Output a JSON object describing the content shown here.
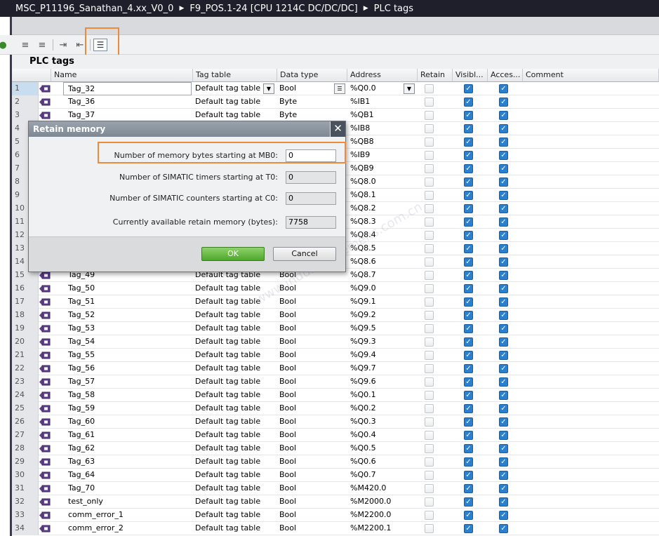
{
  "breadcrumb": [
    {
      "label": "MSC_P11196_Sanathan_4.xx_V0_0"
    },
    {
      "label": "F9_POS.1-24 [CPU 1214C DC/DC/DC]"
    },
    {
      "label": "PLC tags"
    }
  ],
  "toolbar": {
    "buttons": [
      {
        "name": "add-tag-icon",
        "glyph": "≡"
      },
      {
        "name": "insert-tag-icon",
        "glyph": "≡"
      },
      {
        "name": "export-icon",
        "glyph": "⇥"
      },
      {
        "name": "import-icon",
        "glyph": "⇤"
      },
      {
        "name": "retain-memory-icon",
        "glyph": "☰"
      }
    ]
  },
  "section": {
    "title": "PLC tags"
  },
  "columns": {
    "name": "Name",
    "tag_table": "Tag table",
    "data_type": "Data type",
    "address": "Address",
    "retain": "Retain",
    "visible": "Visibl...",
    "accessible": "Acces...",
    "comment": "Comment"
  },
  "rows": [
    {
      "num": "1",
      "name": "Tag_32",
      "table": "Default tag table",
      "type": "Bool",
      "addr": "%Q0.0"
    },
    {
      "num": "2",
      "name": "Tag_36",
      "table": "Default tag table",
      "type": "Byte",
      "addr": "%IB1"
    },
    {
      "num": "3",
      "name": "Tag_37",
      "table": "Default tag table",
      "type": "Byte",
      "addr": "%QB1"
    },
    {
      "num": "4",
      "name": "",
      "table": "",
      "type": "",
      "addr": "%IB8"
    },
    {
      "num": "5",
      "name": "",
      "table": "",
      "type": "",
      "addr": "%QB8"
    },
    {
      "num": "6",
      "name": "",
      "table": "",
      "type": "",
      "addr": "%IB9"
    },
    {
      "num": "7",
      "name": "",
      "table": "",
      "type": "",
      "addr": "%QB9"
    },
    {
      "num": "8",
      "name": "",
      "table": "",
      "type": "",
      "addr": "%Q8.0"
    },
    {
      "num": "9",
      "name": "",
      "table": "",
      "type": "",
      "addr": "%Q8.1"
    },
    {
      "num": "10",
      "name": "",
      "table": "",
      "type": "",
      "addr": "%Q8.2"
    },
    {
      "num": "11",
      "name": "",
      "table": "",
      "type": "",
      "addr": "%Q8.3"
    },
    {
      "num": "12",
      "name": "",
      "table": "",
      "type": "",
      "addr": "%Q8.4"
    },
    {
      "num": "13",
      "name": "",
      "table": "",
      "type": "",
      "addr": "%Q8.5"
    },
    {
      "num": "14",
      "name": "",
      "table": "",
      "type": "",
      "addr": "%Q8.6"
    },
    {
      "num": "15",
      "name": "Tag_49",
      "table": "Default tag table",
      "type": "Bool",
      "addr": "%Q8.7"
    },
    {
      "num": "16",
      "name": "Tag_50",
      "table": "Default tag table",
      "type": "Bool",
      "addr": "%Q9.0"
    },
    {
      "num": "17",
      "name": "Tag_51",
      "table": "Default tag table",
      "type": "Bool",
      "addr": "%Q9.1"
    },
    {
      "num": "18",
      "name": "Tag_52",
      "table": "Default tag table",
      "type": "Bool",
      "addr": "%Q9.2"
    },
    {
      "num": "19",
      "name": "Tag_53",
      "table": "Default tag table",
      "type": "Bool",
      "addr": "%Q9.5"
    },
    {
      "num": "20",
      "name": "Tag_54",
      "table": "Default tag table",
      "type": "Bool",
      "addr": "%Q9.3"
    },
    {
      "num": "21",
      "name": "Tag_55",
      "table": "Default tag table",
      "type": "Bool",
      "addr": "%Q9.4"
    },
    {
      "num": "22",
      "name": "Tag_56",
      "table": "Default tag table",
      "type": "Bool",
      "addr": "%Q9.7"
    },
    {
      "num": "23",
      "name": "Tag_57",
      "table": "Default tag table",
      "type": "Bool",
      "addr": "%Q9.6"
    },
    {
      "num": "24",
      "name": "Tag_58",
      "table": "Default tag table",
      "type": "Bool",
      "addr": "%Q0.1"
    },
    {
      "num": "25",
      "name": "Tag_59",
      "table": "Default tag table",
      "type": "Bool",
      "addr": "%Q0.2"
    },
    {
      "num": "26",
      "name": "Tag_60",
      "table": "Default tag table",
      "type": "Bool",
      "addr": "%Q0.3"
    },
    {
      "num": "27",
      "name": "Tag_61",
      "table": "Default tag table",
      "type": "Bool",
      "addr": "%Q0.4"
    },
    {
      "num": "28",
      "name": "Tag_62",
      "table": "Default tag table",
      "type": "Bool",
      "addr": "%Q0.5"
    },
    {
      "num": "29",
      "name": "Tag_63",
      "table": "Default tag table",
      "type": "Bool",
      "addr": "%Q0.6"
    },
    {
      "num": "30",
      "name": "Tag_64",
      "table": "Default tag table",
      "type": "Bool",
      "addr": "%Q0.7"
    },
    {
      "num": "31",
      "name": "Tag_70",
      "table": "Default tag table",
      "type": "Bool",
      "addr": "%M420.0"
    },
    {
      "num": "32",
      "name": "test_only",
      "table": "Default tag table",
      "type": "Bool",
      "addr": "%M2000.0"
    },
    {
      "num": "33",
      "name": "comm_error_1",
      "table": "Default tag table",
      "type": "Bool",
      "addr": "%M2200.0"
    },
    {
      "num": "34",
      "name": "comm_error_2",
      "table": "Default tag table",
      "type": "Bool",
      "addr": "%M2200.1"
    }
  ],
  "dialog": {
    "title": "Retain memory",
    "close_glyph": "✕",
    "fields": [
      {
        "label": "Number of memory bytes starting at MB0:",
        "value": "0"
      },
      {
        "label": "Number of SIMATIC timers starting at T0:",
        "value": "0"
      },
      {
        "label": "Number of SIMATIC counters starting at C0:",
        "value": "0"
      },
      {
        "label": "Currently available retain memory (bytes):",
        "value": "7758"
      }
    ],
    "ok_label": "OK",
    "cancel_label": "Cancel"
  },
  "watermark": {
    "text": "工控技术论坛",
    "subtext": "www.industry.siemens.com.cn"
  },
  "colors": {
    "accent_highlight": "#ee8a3a",
    "checkbox_checked": "#2a7fcf",
    "ok_button": "#4ea82b"
  }
}
